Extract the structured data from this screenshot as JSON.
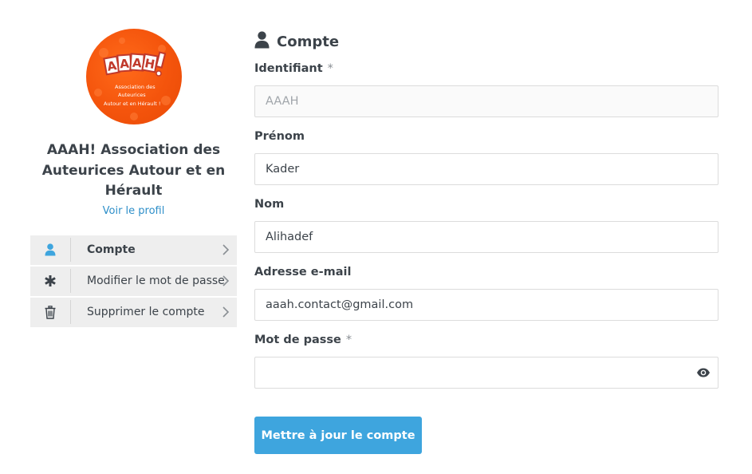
{
  "profile": {
    "logo_text": "AAAH!",
    "logo_caption": [
      "Association des",
      "Auteurices",
      "Autour et en Hérault !"
    ],
    "name": "AAAH! Association des Auteurices Autour et en Hérault",
    "view_profile_link": "Voir le profil"
  },
  "menu": {
    "items": [
      {
        "label": "Compte",
        "icon": "user-icon",
        "active": true
      },
      {
        "label": "Modifier le mot de passe",
        "icon": "asterisk-icon",
        "active": false
      },
      {
        "label": "Supprimer le compte",
        "icon": "trash-icon",
        "active": false
      }
    ]
  },
  "form": {
    "section_title": "Compte",
    "username": {
      "label": "Identifiant",
      "required_mark": "*",
      "placeholder": "AAAH"
    },
    "first_name": {
      "label": "Prénom",
      "value": "Kader"
    },
    "last_name": {
      "label": "Nom",
      "value": "Alihadef"
    },
    "email": {
      "label": "Adresse e-mail",
      "value": "aaah.contact@gmail.com"
    },
    "password": {
      "label": "Mot de passe",
      "required_mark": "*",
      "value": ""
    },
    "submit_label": "Mettre à jour le compte"
  },
  "colors": {
    "accent": "#3ea5de",
    "link": "#2e8fc9",
    "logo_orange": "#f4540c",
    "menu_bg": "#eeeeee",
    "text": "#3c434a"
  }
}
